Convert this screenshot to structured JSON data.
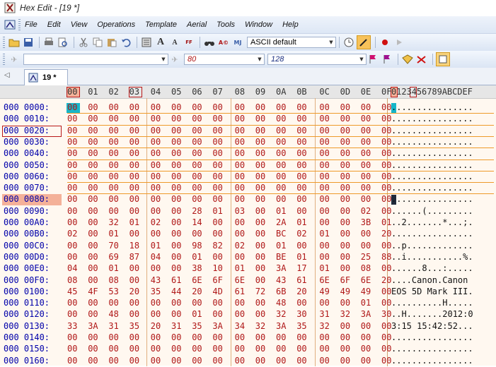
{
  "window": {
    "title": "Hex Edit - [19 *]"
  },
  "menu": [
    "File",
    "Edit",
    "View",
    "Operations",
    "Template",
    "Aerial",
    "Tools",
    "Window",
    "Help"
  ],
  "toolbar": {
    "charset": "ASCII default",
    "field_a": "80",
    "field_b": "128"
  },
  "tab": {
    "label": "19 *"
  },
  "icons": {
    "app": "hexedit-app-icon",
    "new": "new-file-icon",
    "open": "open-folder-icon",
    "save": "save-disk-icon",
    "print": "print-icon",
    "preview": "print-preview-icon",
    "cut": "cut-icon",
    "copy": "copy-icon",
    "paste": "paste-icon",
    "undo": "undo-icon",
    "calc": "calculator-icon",
    "font_up": "font-increase-icon",
    "font_down": "font-decrease-icon",
    "ebcdic": "ebcdic-icon",
    "search": "search-binoculars-icon",
    "replace": "replace-icon",
    "jump": "jump-icon",
    "clock": "history-clock-icon",
    "highlight": "highlighter-icon",
    "record": "record-macro-icon",
    "play": "play-macro-icon",
    "flag": "bookmark-flag-icon",
    "flag2": "bookmark-next-icon",
    "tag": "tag-icon",
    "eraser": "clear-highlight-icon",
    "options": "options-icon"
  },
  "hex": {
    "header": {
      "hex": [
        "00",
        "01",
        "02",
        "03",
        "04",
        "05",
        "06",
        "07",
        "08",
        "09",
        "0A",
        "0B",
        "0C",
        "0D",
        "0E",
        "0F"
      ],
      "ascii": "0123456789ABCDEF"
    },
    "rows": [
      {
        "offset": "000 0000:",
        "bytes": [
          "00",
          "00",
          "00",
          "00",
          "00",
          "00",
          "00",
          "00",
          "00",
          "00",
          "00",
          "00",
          "00",
          "00",
          "00",
          "00"
        ],
        "ascii": "................"
      },
      {
        "offset": "000 0010:",
        "bytes": [
          "00",
          "00",
          "00",
          "00",
          "00",
          "00",
          "00",
          "00",
          "00",
          "00",
          "00",
          "00",
          "00",
          "00",
          "00",
          "00"
        ],
        "ascii": "................"
      },
      {
        "offset": "000 0020:",
        "bytes": [
          "00",
          "00",
          "00",
          "00",
          "00",
          "00",
          "00",
          "00",
          "00",
          "00",
          "00",
          "00",
          "00",
          "00",
          "00",
          "00"
        ],
        "ascii": "................"
      },
      {
        "offset": "000 0030:",
        "bytes": [
          "00",
          "00",
          "00",
          "00",
          "00",
          "00",
          "00",
          "00",
          "00",
          "00",
          "00",
          "00",
          "00",
          "00",
          "00",
          "00"
        ],
        "ascii": "................"
      },
      {
        "offset": "000 0040:",
        "bytes": [
          "00",
          "00",
          "00",
          "00",
          "00",
          "00",
          "00",
          "00",
          "00",
          "00",
          "00",
          "00",
          "00",
          "00",
          "00",
          "00"
        ],
        "ascii": "................"
      },
      {
        "offset": "000 0050:",
        "bytes": [
          "00",
          "00",
          "00",
          "00",
          "00",
          "00",
          "00",
          "00",
          "00",
          "00",
          "00",
          "00",
          "00",
          "00",
          "00",
          "00"
        ],
        "ascii": "................"
      },
      {
        "offset": "000 0060:",
        "bytes": [
          "00",
          "00",
          "00",
          "00",
          "00",
          "00",
          "00",
          "00",
          "00",
          "00",
          "00",
          "00",
          "00",
          "00",
          "00",
          "00"
        ],
        "ascii": "................"
      },
      {
        "offset": "000 0070:",
        "bytes": [
          "00",
          "00",
          "00",
          "00",
          "00",
          "00",
          "00",
          "00",
          "00",
          "00",
          "00",
          "00",
          "00",
          "00",
          "00",
          "00"
        ],
        "ascii": "................"
      },
      {
        "offset": "000 0080:",
        "bytes": [
          "00",
          "00",
          "00",
          "00",
          "00",
          "00",
          "00",
          "00",
          "00",
          "00",
          "00",
          "00",
          "00",
          "00",
          "00",
          "00"
        ],
        "ascii": "................"
      },
      {
        "offset": "000 0090:",
        "bytes": [
          "00",
          "00",
          "00",
          "00",
          "00",
          "00",
          "28",
          "01",
          "03",
          "00",
          "01",
          "00",
          "00",
          "00",
          "02",
          "00"
        ],
        "ascii": "......(........."
      },
      {
        "offset": "000 00A0:",
        "bytes": [
          "00",
          "00",
          "32",
          "01",
          "02",
          "00",
          "14",
          "00",
          "00",
          "00",
          "2A",
          "01",
          "00",
          "00",
          "3B",
          "01"
        ],
        "ascii": "..2.......*...;."
      },
      {
        "offset": "000 00B0:",
        "bytes": [
          "02",
          "00",
          "01",
          "00",
          "00",
          "00",
          "00",
          "00",
          "00",
          "00",
          "BC",
          "02",
          "01",
          "00",
          "00",
          "20"
        ],
        "ascii": "................"
      },
      {
        "offset": "000 00C0:",
        "bytes": [
          "00",
          "00",
          "70",
          "18",
          "01",
          "00",
          "98",
          "82",
          "02",
          "00",
          "01",
          "00",
          "00",
          "00",
          "00",
          "00"
        ],
        "ascii": "..p............."
      },
      {
        "offset": "000 00D0:",
        "bytes": [
          "00",
          "00",
          "69",
          "87",
          "04",
          "00",
          "01",
          "00",
          "00",
          "00",
          "BE",
          "01",
          "00",
          "00",
          "25",
          "88"
        ],
        "ascii": "..i...........%."
      },
      {
        "offset": "000 00E0:",
        "bytes": [
          "04",
          "00",
          "01",
          "00",
          "00",
          "00",
          "38",
          "10",
          "01",
          "00",
          "3A",
          "17",
          "01",
          "00",
          "08",
          "00"
        ],
        "ascii": "......8...:....."
      },
      {
        "offset": "000 00F0:",
        "bytes": [
          "08",
          "00",
          "08",
          "00",
          "43",
          "61",
          "6E",
          "6F",
          "6E",
          "00",
          "43",
          "61",
          "6E",
          "6F",
          "6E",
          "20"
        ],
        "ascii": "....Canon.Canon "
      },
      {
        "offset": "000 0100:",
        "bytes": [
          "45",
          "4F",
          "53",
          "20",
          "35",
          "44",
          "20",
          "4D",
          "61",
          "72",
          "6B",
          "20",
          "49",
          "49",
          "49",
          "00"
        ],
        "ascii": "EOS 5D Mark III."
      },
      {
        "offset": "000 0110:",
        "bytes": [
          "00",
          "00",
          "00",
          "00",
          "00",
          "00",
          "00",
          "00",
          "00",
          "00",
          "48",
          "00",
          "00",
          "00",
          "01",
          "00"
        ],
        "ascii": "..........H....."
      },
      {
        "offset": "000 0120:",
        "bytes": [
          "00",
          "00",
          "48",
          "00",
          "00",
          "00",
          "01",
          "00",
          "00",
          "00",
          "32",
          "30",
          "31",
          "32",
          "3A",
          "30"
        ],
        "ascii": "..H.......2012:0"
      },
      {
        "offset": "000 0130:",
        "bytes": [
          "33",
          "3A",
          "31",
          "35",
          "20",
          "31",
          "35",
          "3A",
          "34",
          "32",
          "3A",
          "35",
          "32",
          "00",
          "00",
          "00"
        ],
        "ascii": "3:15 15:42:52..."
      },
      {
        "offset": "000 0140:",
        "bytes": [
          "00",
          "00",
          "00",
          "00",
          "00",
          "00",
          "00",
          "00",
          "00",
          "00",
          "00",
          "00",
          "00",
          "00",
          "00",
          "00"
        ],
        "ascii": "................"
      },
      {
        "offset": "000 0150:",
        "bytes": [
          "00",
          "00",
          "00",
          "00",
          "00",
          "00",
          "00",
          "00",
          "00",
          "00",
          "00",
          "00",
          "00",
          "00",
          "00",
          "00"
        ],
        "ascii": "................"
      },
      {
        "offset": "000 0160:",
        "bytes": [
          "00",
          "00",
          "00",
          "00",
          "00",
          "00",
          "00",
          "00",
          "00",
          "00",
          "00",
          "00",
          "00",
          "00",
          "00",
          "00"
        ],
        "ascii": "................"
      }
    ]
  }
}
